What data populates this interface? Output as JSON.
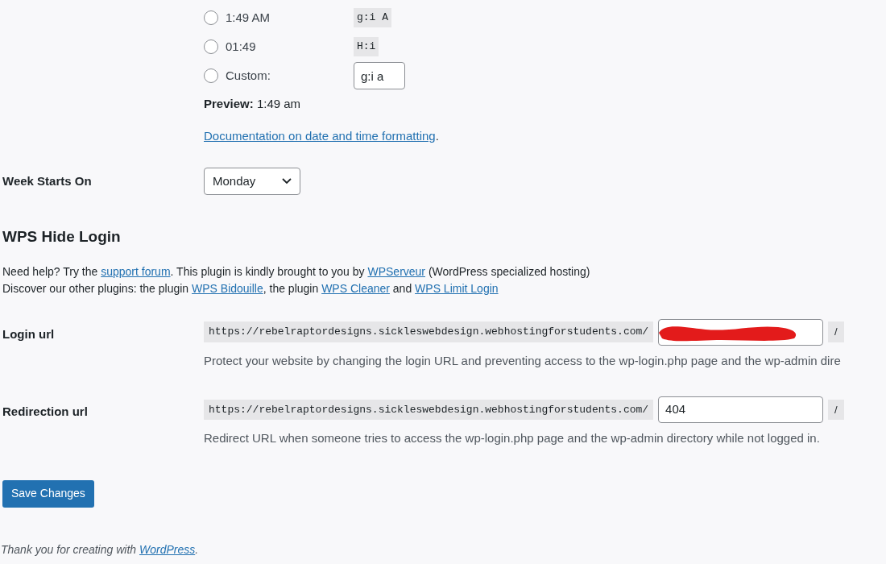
{
  "time_format": {
    "options": [
      {
        "label": "1:49 AM",
        "code": "g:i A",
        "kind": "preset",
        "selected": false
      },
      {
        "label": "01:49",
        "code": "H:i",
        "kind": "preset",
        "selected": false
      },
      {
        "label": "Custom:",
        "code": "g:i a",
        "kind": "custom",
        "selected": false
      }
    ],
    "preview_label": "Preview:",
    "preview_value": "1:49 am",
    "doc_link": "Documentation on date and time formatting",
    "doc_suffix": "."
  },
  "week_starts_on": {
    "label": "Week Starts On",
    "value": "Monday"
  },
  "plugin": {
    "title": "WPS Hide Login",
    "help_lines": [
      [
        {
          "kind": "text",
          "text": "Need help? Try the "
        },
        {
          "kind": "link",
          "text": "support forum"
        },
        {
          "kind": "text",
          "text": ". This plugin is kindly brought to you by "
        },
        {
          "kind": "link",
          "text": "WPServeur"
        },
        {
          "kind": "text",
          "text": " (WordPress specialized hosting)"
        }
      ],
      [
        {
          "kind": "text",
          "text": "Discover our other plugins: the plugin "
        },
        {
          "kind": "link",
          "text": "WPS Bidouille"
        },
        {
          "kind": "text",
          "text": ", the plugin "
        },
        {
          "kind": "link",
          "text": "WPS Cleaner"
        },
        {
          "kind": "text",
          "text": " and "
        },
        {
          "kind": "link",
          "text": "WPS Limit Login"
        }
      ]
    ],
    "fields": [
      {
        "label": "Login url",
        "prefix": "https://rebelraptordesigns.sickleswebdesign.webhostingforstudents.com/",
        "redacted": true,
        "suffix": "/",
        "description": "Protect your website by changing the login URL and preventing access to the wp-login.php page and the wp-admin dire"
      },
      {
        "label": "Redirection url",
        "prefix": "https://rebelraptordesigns.sickleswebdesign.webhostingforstudents.com/",
        "value": "404",
        "redacted": false,
        "suffix": "/",
        "description": "Redirect URL when someone tries to access the wp-login.php page and the wp-admin directory while not logged in."
      }
    ]
  },
  "save_button": "Save Changes",
  "footer": {
    "text": "Thank you for creating with",
    "link": "WordPress",
    "suffix": "."
  }
}
